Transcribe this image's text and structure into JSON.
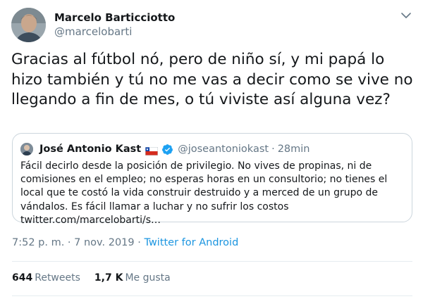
{
  "author": {
    "name": "Marcelo Barticciotto",
    "handle": "@marcelobarti"
  },
  "tweet": {
    "text": "Gracias al fútbol nó, pero de niño sí, y mi papá lo hizo también y tú no me vas a decir como se vive no llegando a fin de mes, o tú viviste así alguna vez?"
  },
  "quoted": {
    "name": "José Antonio Kast",
    "handle": "@joseantoniokast",
    "separator": "·",
    "time": "28min",
    "text": "Fácil decirlo desde la posición de privilegio. No vives de propinas, ni de comisiones en el empleo; no esperas horas en un consultorio; no tienes el local que te costó la vida construir destruido y a merced de un grupo de vándalos. Es fácil llamar a luchar y no sufrir los costos twitter.com/marcelobarti/s…",
    "flag_icon": "chile-flag-icon",
    "verified_icon": "verified-badge-icon"
  },
  "meta": {
    "time": "7:52 p. m.",
    "separator1": " · ",
    "date": "7 nov. 2019",
    "separator2": " · ",
    "source": "Twitter for Android"
  },
  "stats": {
    "retweets_count": "644",
    "retweets_label": "Retweets",
    "likes_count": "1,7 K",
    "likes_label": "Me gusta"
  },
  "colors": {
    "text": "#14171a",
    "secondary": "#657786",
    "link": "#1b95e0",
    "border": "#ccd6dd",
    "verified": "#1da1f2"
  }
}
